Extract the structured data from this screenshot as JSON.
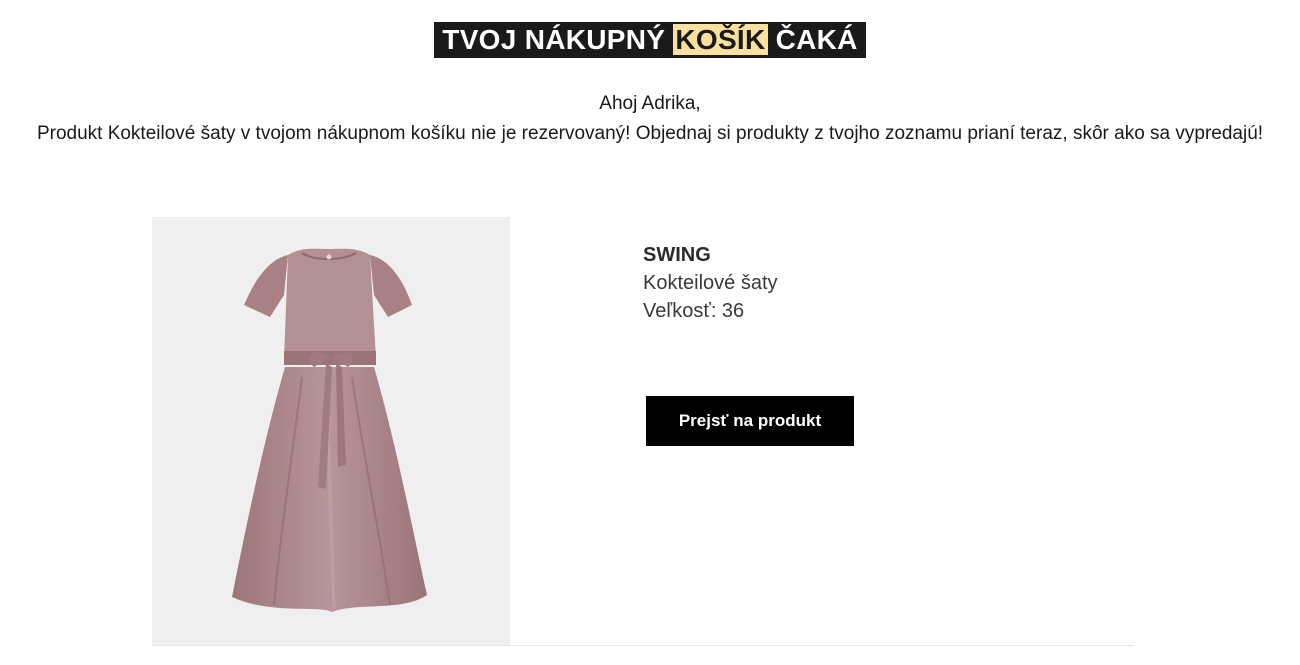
{
  "headline": {
    "part_before": "TVOJ NÁKUPNÝ ",
    "part_highlight": "KOŠÍK",
    "part_after": " ČAKÁ",
    "highlight_color": "#fbe1a0",
    "background_color": "#1a1a1a"
  },
  "greeting": "Ahoj Adrika,",
  "message": "Produkt Kokteilové šaty v tvojom nákupnom košíku nie je rezervovaný! Objednaj si produkty z tvojho zoznamu prianí teraz, skôr ako sa vypredajú!",
  "product": {
    "brand": "SWING",
    "name": "Kokteilové šaty",
    "size": "Veľkosť: 36",
    "image_icon": "dress-image",
    "dress_color": "#b08a8c"
  },
  "cta": {
    "label": "Prejsť na produkt"
  }
}
